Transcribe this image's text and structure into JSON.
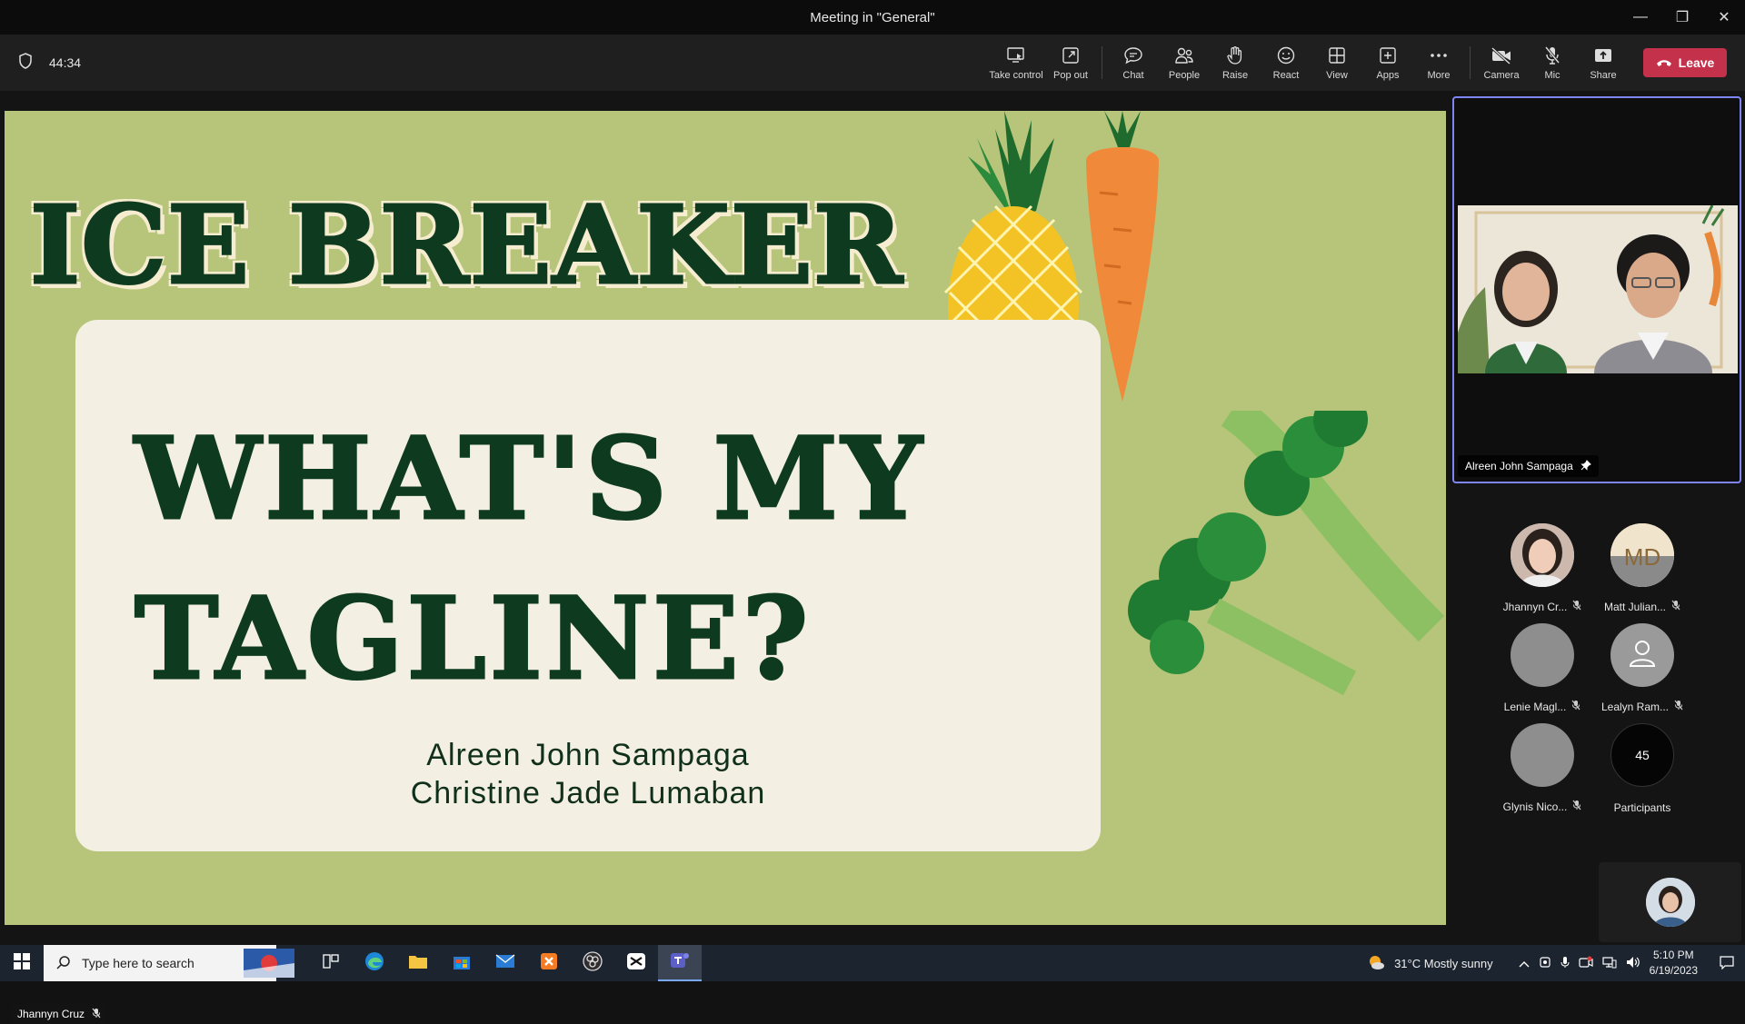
{
  "window": {
    "title": "Meeting in \"General\"",
    "minimize": "—",
    "restore": "❐",
    "close": "✕"
  },
  "toolbar": {
    "timer": "44:34",
    "buttons": [
      {
        "id": "take-control",
        "label": "Take control"
      },
      {
        "id": "pop-out",
        "label": "Pop out"
      },
      {
        "id": "chat",
        "label": "Chat"
      },
      {
        "id": "people",
        "label": "People"
      },
      {
        "id": "raise",
        "label": "Raise"
      },
      {
        "id": "react",
        "label": "React"
      },
      {
        "id": "view",
        "label": "View"
      },
      {
        "id": "apps",
        "label": "Apps"
      },
      {
        "id": "more",
        "label": "More"
      },
      {
        "id": "camera",
        "label": "Camera"
      },
      {
        "id": "mic",
        "label": "Mic"
      },
      {
        "id": "share",
        "label": "Share"
      }
    ],
    "leave_label": "Leave",
    "leave_color": "#c4314b"
  },
  "slide": {
    "title": "ICE BREAKER",
    "heading_line1": "WHAT'S MY",
    "heading_line2": "TAGLINE?",
    "name1": "Alreen John Sampaga",
    "name2": "Christine Jade Lumaban",
    "background": "#b7c57b",
    "card_color": "#f4efe3",
    "text_color": "#0e3b1f"
  },
  "stage": {
    "presenter_name": "Jhannyn Cruz"
  },
  "pinned": {
    "name": "Alreen John Sampaga",
    "pin_icon": "pin-icon"
  },
  "participants": [
    {
      "name": "Jhannyn Cr...",
      "muted": true
    },
    {
      "name": "Matt Julian...",
      "initials": "MD",
      "muted": true
    },
    {
      "name": "Lenie Magl...",
      "muted": true
    },
    {
      "name": "Lealyn Ram...",
      "muted": true
    },
    {
      "name": "Glynis Nico...",
      "muted": true
    }
  ],
  "participants_count": {
    "count": "45",
    "label": "Participants"
  },
  "taskbar": {
    "search_placeholder": "Type here to search",
    "weather": "31°C  Mostly sunny",
    "time": "5:10 PM",
    "date": "6/19/2023"
  }
}
